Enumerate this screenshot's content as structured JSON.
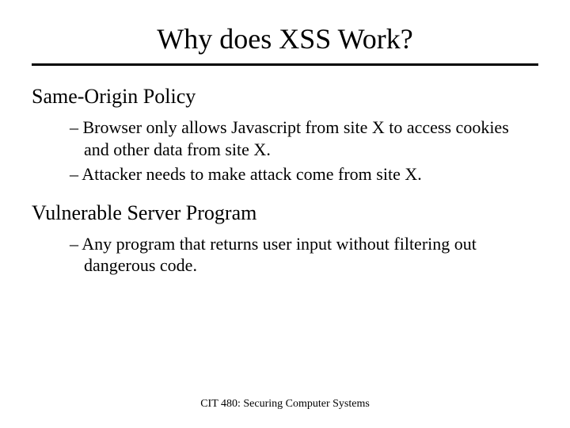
{
  "title": "Why does XSS Work?",
  "sections": [
    {
      "heading": "Same-Origin Policy",
      "bullets": [
        "Browser only allows Javascript from site X to access cookies and other data from site X.",
        "Attacker needs to make attack come from site X."
      ]
    },
    {
      "heading": "Vulnerable Server Program",
      "bullets": [
        "Any program that returns user input without filtering out dangerous code."
      ]
    }
  ],
  "footer": "CIT 480: Securing Computer Systems"
}
